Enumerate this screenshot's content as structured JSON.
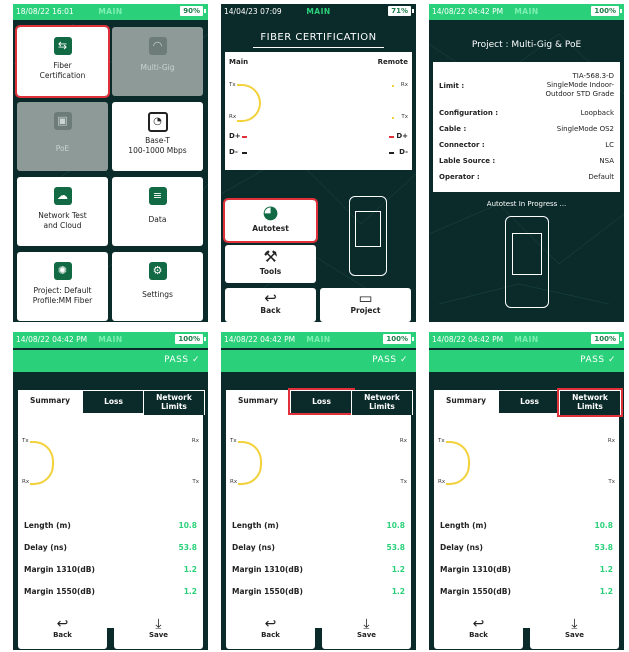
{
  "s1": {
    "status": {
      "time": "18/08/22 16:01",
      "mode": "MAIN",
      "battery": "90%"
    },
    "tiles": [
      {
        "label": "Fiber\nCertification",
        "icon": "fiber-icon"
      },
      {
        "label": "Multi-Gig",
        "icon": "gauge-icon"
      },
      {
        "label": "PoE",
        "icon": "poe-icon"
      },
      {
        "label": "Base-T\n100-1000 Mbps",
        "icon": "speedometer-icon"
      },
      {
        "label": "Network Test\nand Cloud",
        "icon": "cloud-icon"
      },
      {
        "label": "Data",
        "icon": "database-icon"
      },
      {
        "label": "Project: Default\nProfile:MM Fiber",
        "icon": "bulb-icon"
      },
      {
        "label": "Settings",
        "icon": "gear-icon"
      }
    ]
  },
  "s2": {
    "status": {
      "time": "14/04/23 07:09",
      "mode": "MAIN",
      "battery": "71%"
    },
    "title": "FIBER CERTIFICATION",
    "main": "Main",
    "remote": "Remote",
    "tx": "Tx",
    "rx": "Rx",
    "dplus": "D+",
    "dminus": "D-",
    "autotest": "Autotest",
    "tools": "Tools",
    "back": "Back",
    "project": "Project"
  },
  "s3": {
    "status": {
      "time": "14/08/22 04:42 PM",
      "mode": "MAIN",
      "battery": "100%"
    },
    "title": "Project : Multi-Gig & PoE",
    "rows": [
      {
        "k": "Limit :",
        "v": "TIA-568.3-D\nSingleMode Indoor-\nOutdoor STD Grade"
      },
      {
        "k": "Configuration :",
        "v": "Loopback"
      },
      {
        "k": "Cable :",
        "v": "SingleMode OS2"
      },
      {
        "k": "Connector :",
        "v": "LC"
      },
      {
        "k": "Lable Source :",
        "v": "NSA"
      },
      {
        "k": "Operator :",
        "v": "Default"
      }
    ],
    "progress": "Autotest In Progress ..."
  },
  "res": {
    "status": {
      "time": "14/08/22 04:42 PM",
      "mode": "MAIN",
      "battery": "100%"
    },
    "pass": "PASS",
    "tabs": [
      "Summary",
      "Loss",
      "Network\nLimits"
    ],
    "tx": "Tx",
    "rx": "Rx",
    "metrics": [
      {
        "k": "Length (m)",
        "v": "10.8"
      },
      {
        "k": "Delay (ns)",
        "v": "53.8"
      },
      {
        "k": "Margin 1310(dB)",
        "v": "1.2"
      },
      {
        "k": "Margin 1550(dB)",
        "v": "1.2"
      }
    ],
    "back": "Back",
    "save": "Save"
  }
}
